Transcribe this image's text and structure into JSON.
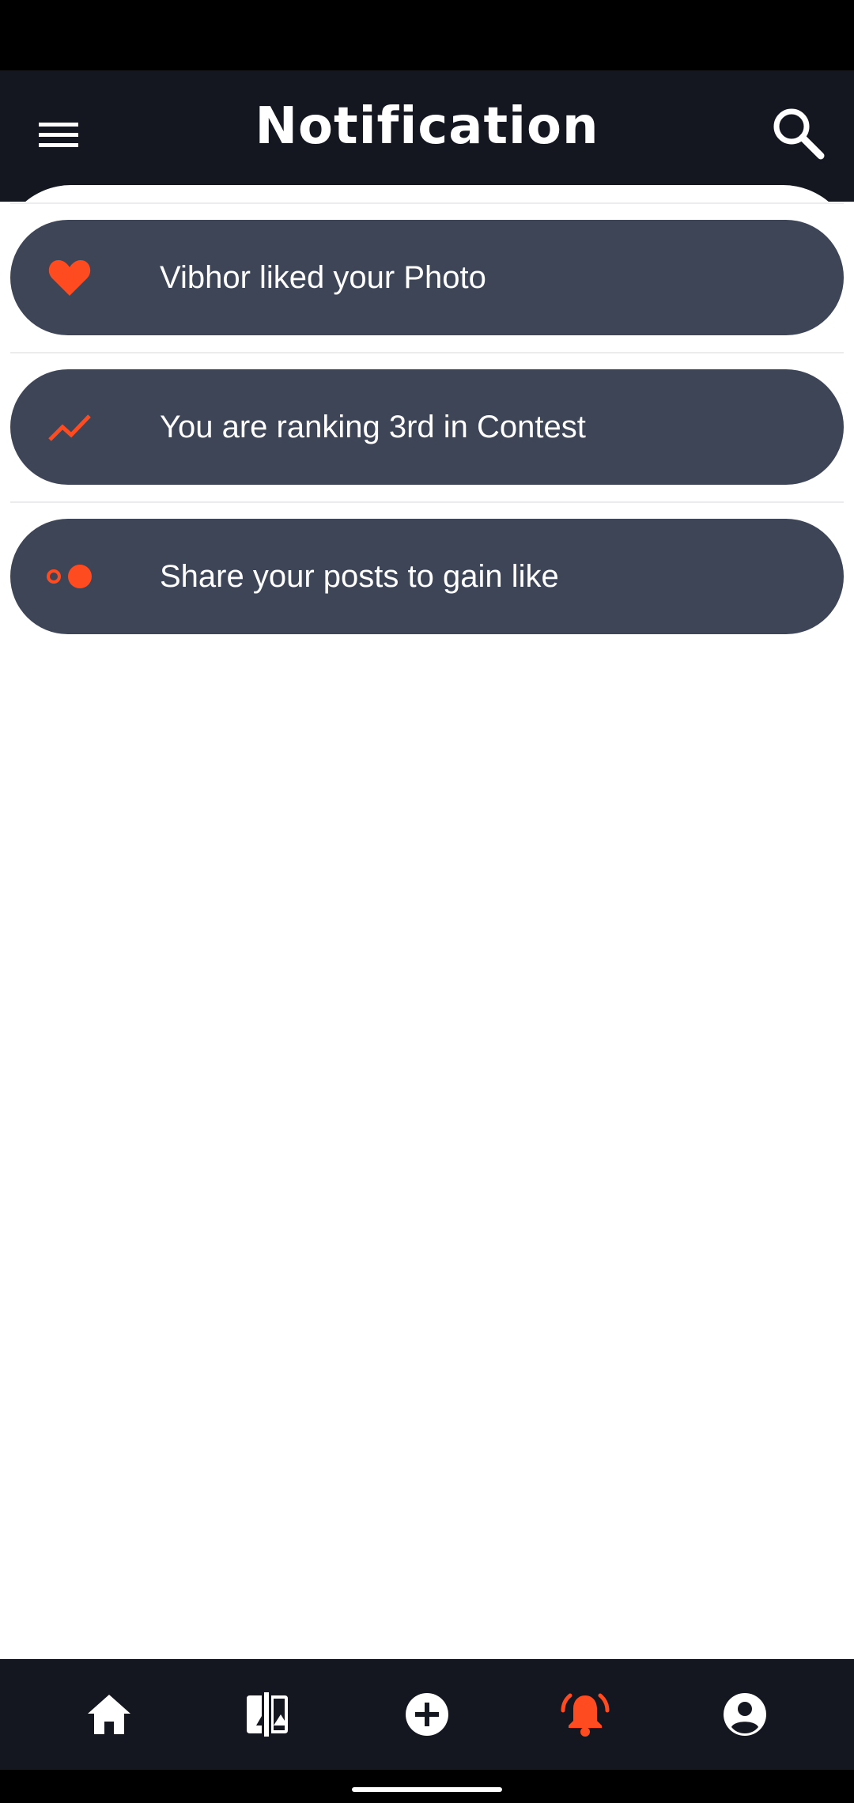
{
  "header": {
    "title": "Notification",
    "menu_icon": "menu-icon",
    "search_icon": "search-icon"
  },
  "notifications": [
    {
      "icon": "heart-icon",
      "text": "Vibhor liked your Photo"
    },
    {
      "icon": "trending-up-icon",
      "text": "You are ranking 3rd in Contest"
    },
    {
      "icon": "toggle-dots-icon",
      "text": "Share your posts to gain like"
    }
  ],
  "bottom_nav": [
    {
      "icon": "home-icon",
      "active": false
    },
    {
      "icon": "compare-icon",
      "active": false
    },
    {
      "icon": "add-circle-icon",
      "active": false
    },
    {
      "icon": "bell-ringing-icon",
      "active": true
    },
    {
      "icon": "account-circle-icon",
      "active": false
    }
  ],
  "colors": {
    "background": "#ffffff",
    "app_bar": "#141720",
    "card": "#3d4557",
    "accent": "#ff4b1f",
    "text_light": "#ffffff"
  }
}
